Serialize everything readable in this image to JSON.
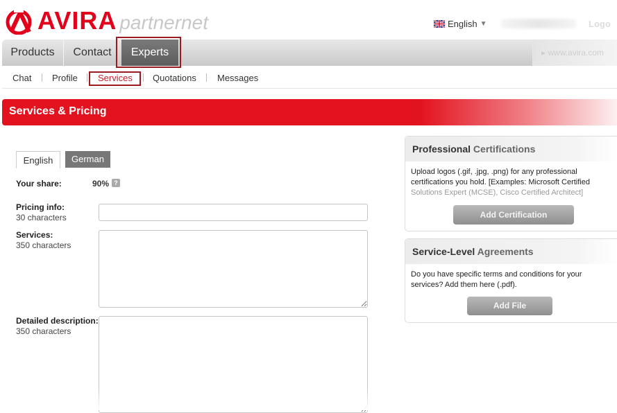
{
  "header": {
    "brand": "AVIRA",
    "brand_suffix": "partnernet",
    "language": "English",
    "logout": "Logo",
    "site_link": "www.avira.com"
  },
  "main_nav": {
    "items": [
      "Products",
      "Contact",
      "Experts"
    ],
    "active": "Experts"
  },
  "sub_nav": {
    "items": [
      "Chat",
      "Profile",
      "Services",
      "Quotations",
      "Messages"
    ],
    "active": "Services"
  },
  "page": {
    "title": "Services & Pricing"
  },
  "lang_tabs": [
    "English",
    "German"
  ],
  "form": {
    "share_label": "Your share:",
    "share_value": "90%",
    "help_icon": "?",
    "pricing_label": "Pricing info:",
    "pricing_hint": "30 characters",
    "pricing_value": "",
    "services_label": "Services:",
    "services_hint": "350 characters",
    "services_value": "",
    "detail_label": "Detailed description:",
    "detail_hint": "350 characters",
    "detail_value": ""
  },
  "panels": {
    "certifications": {
      "title_bold": "Professional",
      "title_rest": "Certifications",
      "text_1": "Upload logos (.gif, .jpg, .png) for any professional",
      "text_2": "certifications you hold. [Examples: Microsoft Certified",
      "text_3": "Solutions Expert (MCSE), Cisco Certified Architect]",
      "button": "Add Certification"
    },
    "sla": {
      "title_bold": "Service-Level",
      "title_rest": "Agreements",
      "text_1": "Do you have specific terms and conditions for your",
      "text_2": "services? Add them here (.pdf).",
      "button": "Add File"
    }
  },
  "colors": {
    "brand_red": "#e2001a",
    "highlight_frame": "#9b1a1f",
    "active_tab": "#5c5c5c"
  }
}
